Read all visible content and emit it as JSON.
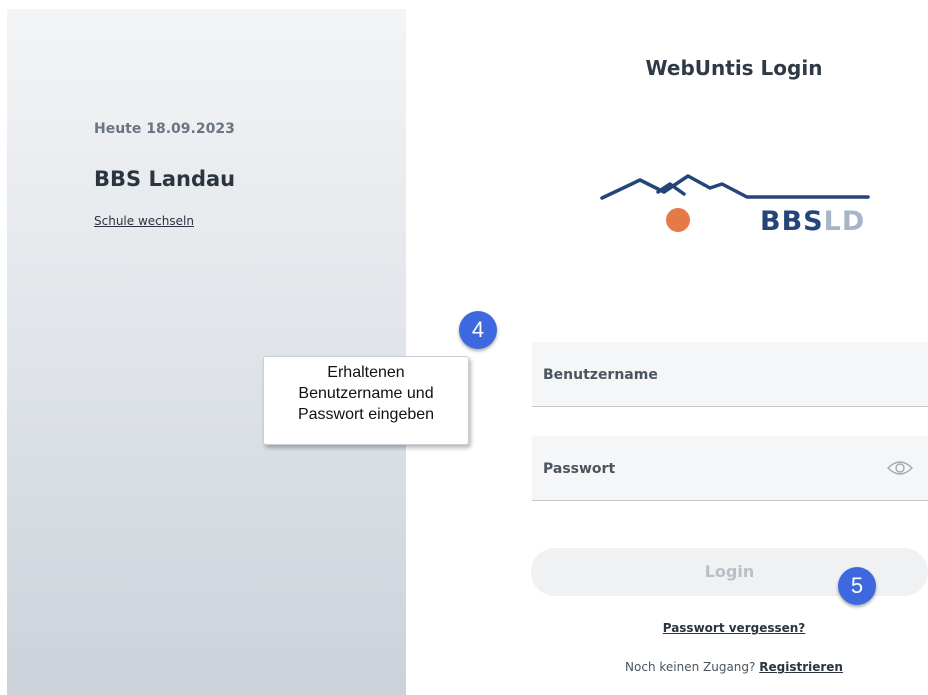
{
  "left": {
    "date": "Heute 18.09.2023",
    "school_name": "BBS Landau",
    "switch_school": "Schule wechseln"
  },
  "login": {
    "title": "WebUntis Login",
    "logo": {
      "text_bold": "BBS",
      "text_light": "LD",
      "brand_color": "#24447a",
      "accent_color": "#e67a46"
    },
    "username_label": "Benutzername",
    "password_label": "Passwort",
    "login_button": "Login",
    "forgot_password": "Passwort vergessen?",
    "no_access": "Noch keinen Zugang?",
    "register": "Registrieren"
  },
  "annotations": {
    "badge_4": "4",
    "badge_5": "5",
    "callout_lines": [
      "Erhaltenen",
      "Benutzername und",
      "Passwort eingeben"
    ]
  }
}
